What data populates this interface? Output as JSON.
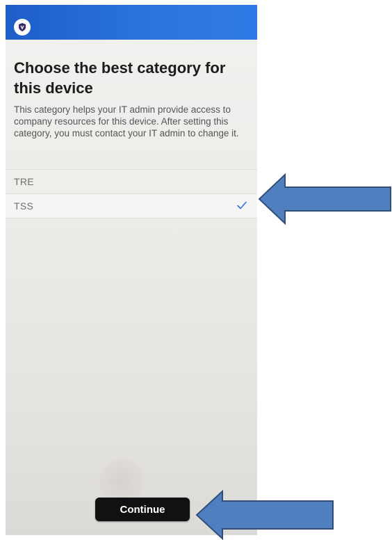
{
  "header": {
    "app_icon": "shield-icon",
    "accent": "#2a73de"
  },
  "main": {
    "title": "Choose the best category for this device",
    "description": "This category helps your IT admin provide access to company resources for this device. After setting this category, you must contact your IT admin to change it.",
    "categories": [
      {
        "label": "TRE",
        "selected": false
      },
      {
        "label": "TSS",
        "selected": true
      }
    ],
    "check_color": "#2f6fd6"
  },
  "footer": {
    "continue_label": "Continue"
  },
  "annotations": {
    "arrow_color": "#4f7fbf"
  }
}
